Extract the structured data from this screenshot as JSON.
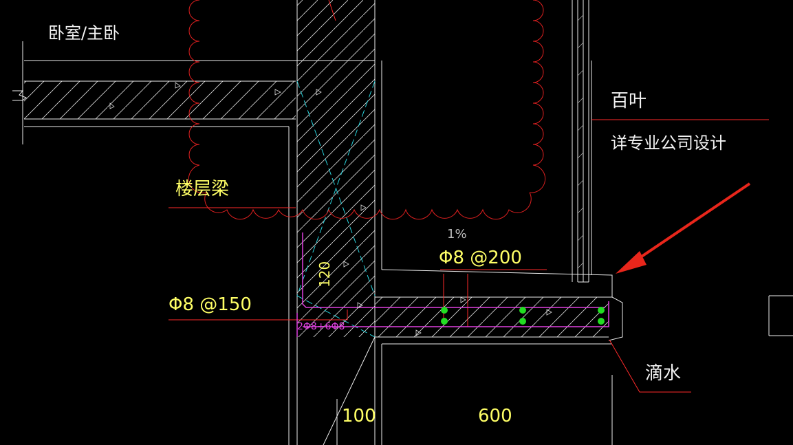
{
  "labels": {
    "room": "卧室/主卧",
    "blinds": "百叶",
    "blinds_note": "详专业公司设计",
    "floor_beam": "楼层梁",
    "rebar_top": "Φ8 @200",
    "rebar_side": "Φ8 @150",
    "rebar_small": "2Φ8+6Φ8",
    "slope": "1%",
    "dim_120": "120",
    "drip": "滴水",
    "dim_100": "100",
    "dim_600": "600"
  },
  "colors": {
    "background": "#000000",
    "line": "#ffffff",
    "leader": "#ff2a2a",
    "rebar": "#e040e0",
    "rebar_dot": "#22dd22",
    "cyan": "#2ad4dd",
    "text_yellow": "#ffff66",
    "arrow": "#e8261b"
  }
}
